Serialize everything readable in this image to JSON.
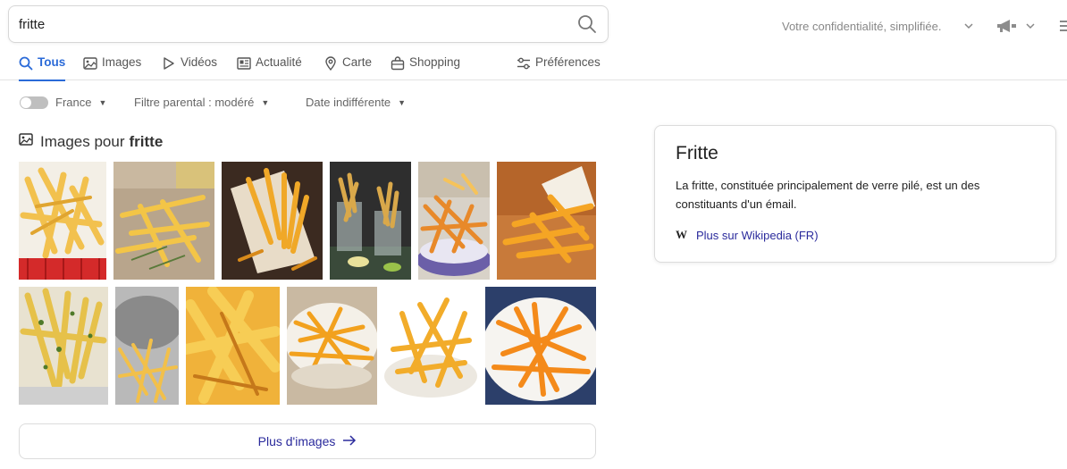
{
  "search": {
    "query": "fritte"
  },
  "header": {
    "privacy_text": "Votre confidentialité, simplifiée."
  },
  "tabs": [
    {
      "label": "Tous",
      "icon": "search-icon",
      "active": true
    },
    {
      "label": "Images",
      "icon": "image-icon"
    },
    {
      "label": "Vidéos",
      "icon": "play-icon"
    },
    {
      "label": "Actualité",
      "icon": "news-icon"
    },
    {
      "label": "Carte",
      "icon": "map-pin-icon"
    },
    {
      "label": "Shopping",
      "icon": "shopping-bag-icon"
    }
  ],
  "preferences": {
    "label": "Préférences",
    "icon": "sliders-icon"
  },
  "filters": {
    "region": "France",
    "safe_search": "Filtre parental : modéré",
    "date": "Date indifférente"
  },
  "images_section": {
    "heading_prefix": "Images pour",
    "heading_query": "fritte",
    "thumbnails": [
      "Frites dans un panier rouge",
      "Frites au romarin sur planche",
      "Frites dans un cornet en papier",
      "Frites en verres sur ardoise",
      "Frites dans une assiette",
      "Frites sur table en bois",
      "Frites aux herbes dans un panier",
      "Frites dans une passoire",
      "Frites en gros plan",
      "Frites dans un bol",
      "Frites sur assiette blanche",
      "Frites sur assiette bleue"
    ],
    "more_label": "Plus d'images"
  },
  "knowledge_panel": {
    "title": "Fritte",
    "description": "La fritte, constituée principalement de verre pilé, est un des constituants d'un émail.",
    "wiki_glyph": "W",
    "link_label": "Plus sur Wikipedia (FR)"
  },
  "colors": {
    "accent": "#2a6ad8",
    "link": "#2a2a9c",
    "muted": "#888888"
  }
}
